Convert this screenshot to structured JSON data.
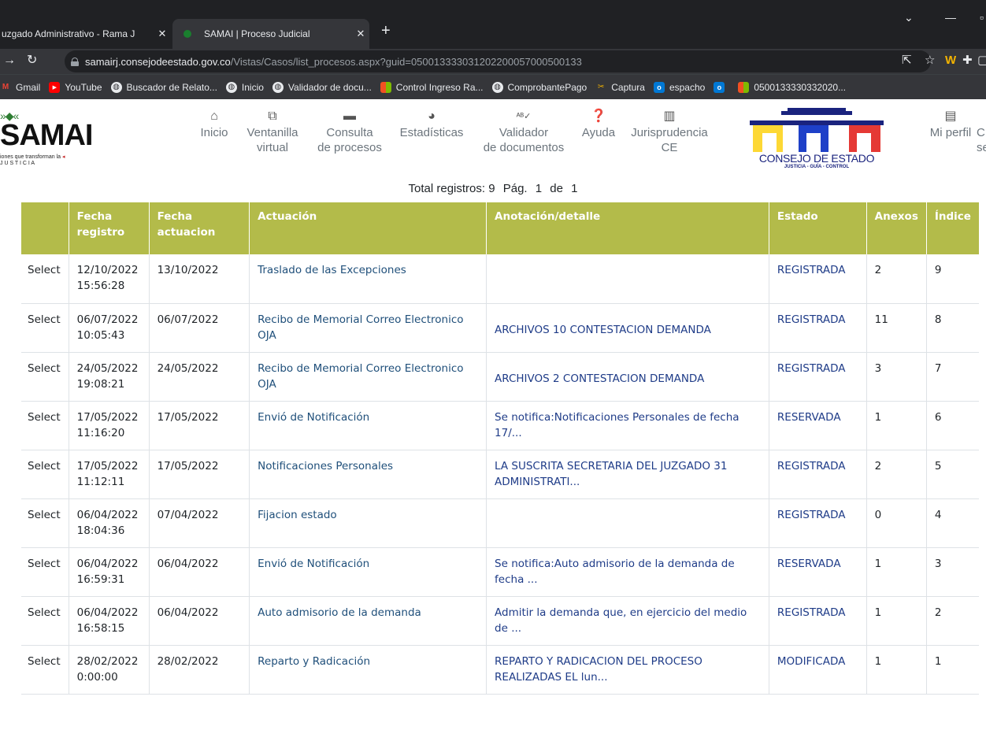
{
  "browser": {
    "tabs": [
      {
        "title": "uzgado Administrativo - Rama J"
      },
      {
        "title": "SAMAI | Proceso Judicial"
      }
    ],
    "url_host": "samairj.consejodeestado.gov.co",
    "url_path": "/Vistas/Casos/list_procesos.aspx?guid=050013333031202200057000500133",
    "bookmarks": [
      {
        "label": "Gmail",
        "icon": "gmail-icon"
      },
      {
        "label": "YouTube",
        "icon": "youtube-icon"
      },
      {
        "label": "Buscador de Relato...",
        "icon": "globe-icon"
      },
      {
        "label": "Inicio",
        "icon": "globe-icon"
      },
      {
        "label": "Validador de docu...",
        "icon": "globe-icon"
      },
      {
        "label": "Control Ingreso Ra...",
        "icon": "windows-icon"
      },
      {
        "label": "ComprobantePago",
        "icon": "globe-icon"
      },
      {
        "label": "Captura",
        "icon": "capture-icon"
      },
      {
        "label": "espacho",
        "icon": "outlook-icon"
      },
      {
        "label": "",
        "icon": "outlook-icon"
      },
      {
        "label": "0500133330332020...",
        "icon": "windows-icon"
      }
    ]
  },
  "header": {
    "logo_text": "SAMAI",
    "logo_tagline_1": "iones que transforman la",
    "logo_tagline_2": "J U S T I C I A",
    "nav": [
      {
        "label_1": "Inicio",
        "label_2": "",
        "icon": "home-icon"
      },
      {
        "label_1": "Ventanilla",
        "label_2": "virtual",
        "icon": "window-icon"
      },
      {
        "label_1": "Consulta",
        "label_2": "de procesos",
        "icon": "folder-icon"
      },
      {
        "label_1": "Estadísticas",
        "label_2": "",
        "icon": "pie-chart-icon"
      },
      {
        "label_1": "Validador",
        "label_2": "de documentos",
        "icon": "spellcheck-icon"
      },
      {
        "label_1": "Ayuda",
        "label_2": "",
        "icon": "help-icon"
      },
      {
        "label_1": "Jurisprudencia",
        "label_2": "CE",
        "icon": "books-icon"
      },
      {
        "label_1": "Mi perfil",
        "label_2": "",
        "icon": "profile-card-icon"
      },
      {
        "label_1": "C",
        "label_2": "se",
        "icon": ""
      }
    ],
    "ce_title": "CONSEJO DE ESTADO",
    "ce_subtitle": "JUSTICIA - GUÍA - CONTROL"
  },
  "pager": {
    "total_label": "Total registros: 9",
    "page_label": "Pág.",
    "page": "1",
    "of_label": "de",
    "pages": "1"
  },
  "table": {
    "headers": [
      "",
      "Fecha registro",
      "Fecha actuacion",
      "Actuación",
      "Anotación/detalle",
      "Estado",
      "Anexos",
      "Índice"
    ],
    "rows": [
      {
        "select": "Select",
        "reg_date": "12/10/2022",
        "reg_time": "15:56:28",
        "act_date": "13/10/2022",
        "actuacion": "Traslado de las Excepciones",
        "anotacion": "",
        "estado": "REGISTRADA",
        "anexos": "2",
        "indice": "9"
      },
      {
        "select": "Select",
        "reg_date": "06/07/2022",
        "reg_time": "10:05:43",
        "act_date": "06/07/2022",
        "actuacion": "Recibo de Memorial Correo Electronico OJA",
        "anotacion": "ARCHIVOS 10 CONTESTACION DEMANDA",
        "estado": "REGISTRADA",
        "anexos": "11",
        "indice": "8"
      },
      {
        "select": "Select",
        "reg_date": "24/05/2022",
        "reg_time": "19:08:21",
        "act_date": "24/05/2022",
        "actuacion": "Recibo de Memorial Correo Electronico OJA",
        "anotacion": "ARCHIVOS 2 CONTESTACION DEMANDA",
        "estado": "REGISTRADA",
        "anexos": "3",
        "indice": "7"
      },
      {
        "select": "Select",
        "reg_date": "17/05/2022",
        "reg_time": "11:16:20",
        "act_date": "17/05/2022",
        "actuacion": "Envió de Notificación",
        "anotacion": "Se notifica:Notificaciones Personales de fecha 17/...",
        "estado": "RESERVADA",
        "anexos": "1",
        "indice": "6"
      },
      {
        "select": "Select",
        "reg_date": "17/05/2022",
        "reg_time": "11:12:11",
        "act_date": "17/05/2022",
        "actuacion": "Notificaciones Personales",
        "anotacion": "LA SUSCRITA SECRETARIA DEL JUZGADO 31 ADMINISTRATI...",
        "estado": "REGISTRADA",
        "anexos": "2",
        "indice": "5"
      },
      {
        "select": "Select",
        "reg_date": "06/04/2022",
        "reg_time": "18:04:36",
        "act_date": "07/04/2022",
        "actuacion": "Fijacion estado",
        "anotacion": "",
        "estado": "REGISTRADA",
        "anexos": "0",
        "indice": "4"
      },
      {
        "select": "Select",
        "reg_date": "06/04/2022",
        "reg_time": "16:59:31",
        "act_date": "06/04/2022",
        "actuacion": "Envió de Notificación",
        "anotacion": "Se notifica:Auto admisorio de la demanda de fecha ...",
        "estado": "RESERVADA",
        "anexos": "1",
        "indice": "3"
      },
      {
        "select": "Select",
        "reg_date": "06/04/2022",
        "reg_time": "16:58:15",
        "act_date": "06/04/2022",
        "actuacion": "Auto admisorio de la demanda",
        "anotacion": "Admitir la demanda que, en ejercicio del medio de ...",
        "estado": "REGISTRADA",
        "anexos": "1",
        "indice": "2"
      },
      {
        "select": "Select",
        "reg_date": "28/02/2022",
        "reg_time": "0:00:00",
        "act_date": "28/02/2022",
        "actuacion": "Reparto y Radicación",
        "anotacion": "REPARTO Y RADICACION DEL PROCESO REALIZADAS EL lun...",
        "estado": "MODIFICADA",
        "anexos": "1",
        "indice": "1"
      }
    ]
  },
  "colors": {
    "header_bg": "#b3bb4a",
    "link_blue": "#1f3c88",
    "chrome_dark": "#202124",
    "chrome_mid": "#35363a"
  }
}
